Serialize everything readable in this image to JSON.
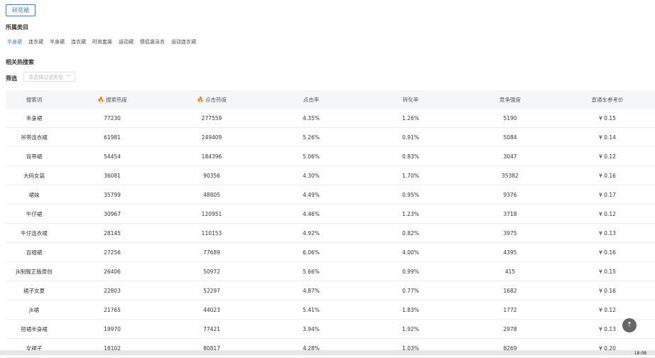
{
  "keyword": "碎花裙",
  "category_title": "所属类目",
  "categories": [
    "半身裙",
    "连衣裙",
    "半身裙",
    "连衣裙",
    "时尚套装",
    "运动裙",
    "情侣装泳衣",
    "运动连衣裙"
  ],
  "related_title": "相关热搜索",
  "filter": {
    "label": "筛选",
    "placeholder": "请选择过滤类型"
  },
  "table": {
    "headers": [
      "搜索词",
      "搜索热度",
      "点击热度",
      "点击率",
      "转化率",
      "竞争强度",
      "直通车参考价"
    ],
    "rows": [
      [
        "半身裙",
        "77230",
        "277559",
        "4.35%",
        "1.26%",
        "5190",
        "¥ 0.15"
      ],
      [
        "吊带连衣裙",
        "61981",
        "249409",
        "5.26%",
        "0.91%",
        "5084",
        "¥ 0.14"
      ],
      [
        "背带裙",
        "54454",
        "184396",
        "5.06%",
        "0.83%",
        "3047",
        "¥ 0.12"
      ],
      [
        "大码女装",
        "36081",
        "90356",
        "4.30%",
        "1.70%",
        "35382",
        "¥ 0.16"
      ],
      [
        "裙妹",
        "35799",
        "48805",
        "4.49%",
        "0.95%",
        "9376",
        "¥ 0.17"
      ],
      [
        "牛仔裙",
        "30967",
        "120951",
        "4.46%",
        "1.23%",
        "3718",
        "¥ 0.12"
      ],
      [
        "牛仔连衣裙",
        "28145",
        "110153",
        "4.92%",
        "0.82%",
        "3975",
        "¥ 0.13"
      ],
      [
        "百褶裙",
        "27256",
        "77689",
        "6.06%",
        "4.00%",
        "4395",
        "¥ 0.16"
      ],
      [
        "jk制服正版原创",
        "26406",
        "50972",
        "5.66%",
        "0.99%",
        "415",
        "¥ 0.15"
      ],
      [
        "裙子女夏",
        "22803",
        "52297",
        "4.87%",
        "0.77%",
        "1682",
        "¥ 0.16"
      ],
      [
        "jk裙",
        "21765",
        "44023",
        "5.41%",
        "1.83%",
        "1772",
        "¥ 0.12"
      ],
      [
        "短裙半身裙",
        "19970",
        "77421",
        "3.94%",
        "1.92%",
        "2978",
        "¥ 0.13"
      ],
      [
        "女裙子",
        "18102",
        "80817",
        "4.28%",
        "1.03%",
        "8269",
        "¥ 0.20"
      ]
    ]
  },
  "clock": "18:08"
}
